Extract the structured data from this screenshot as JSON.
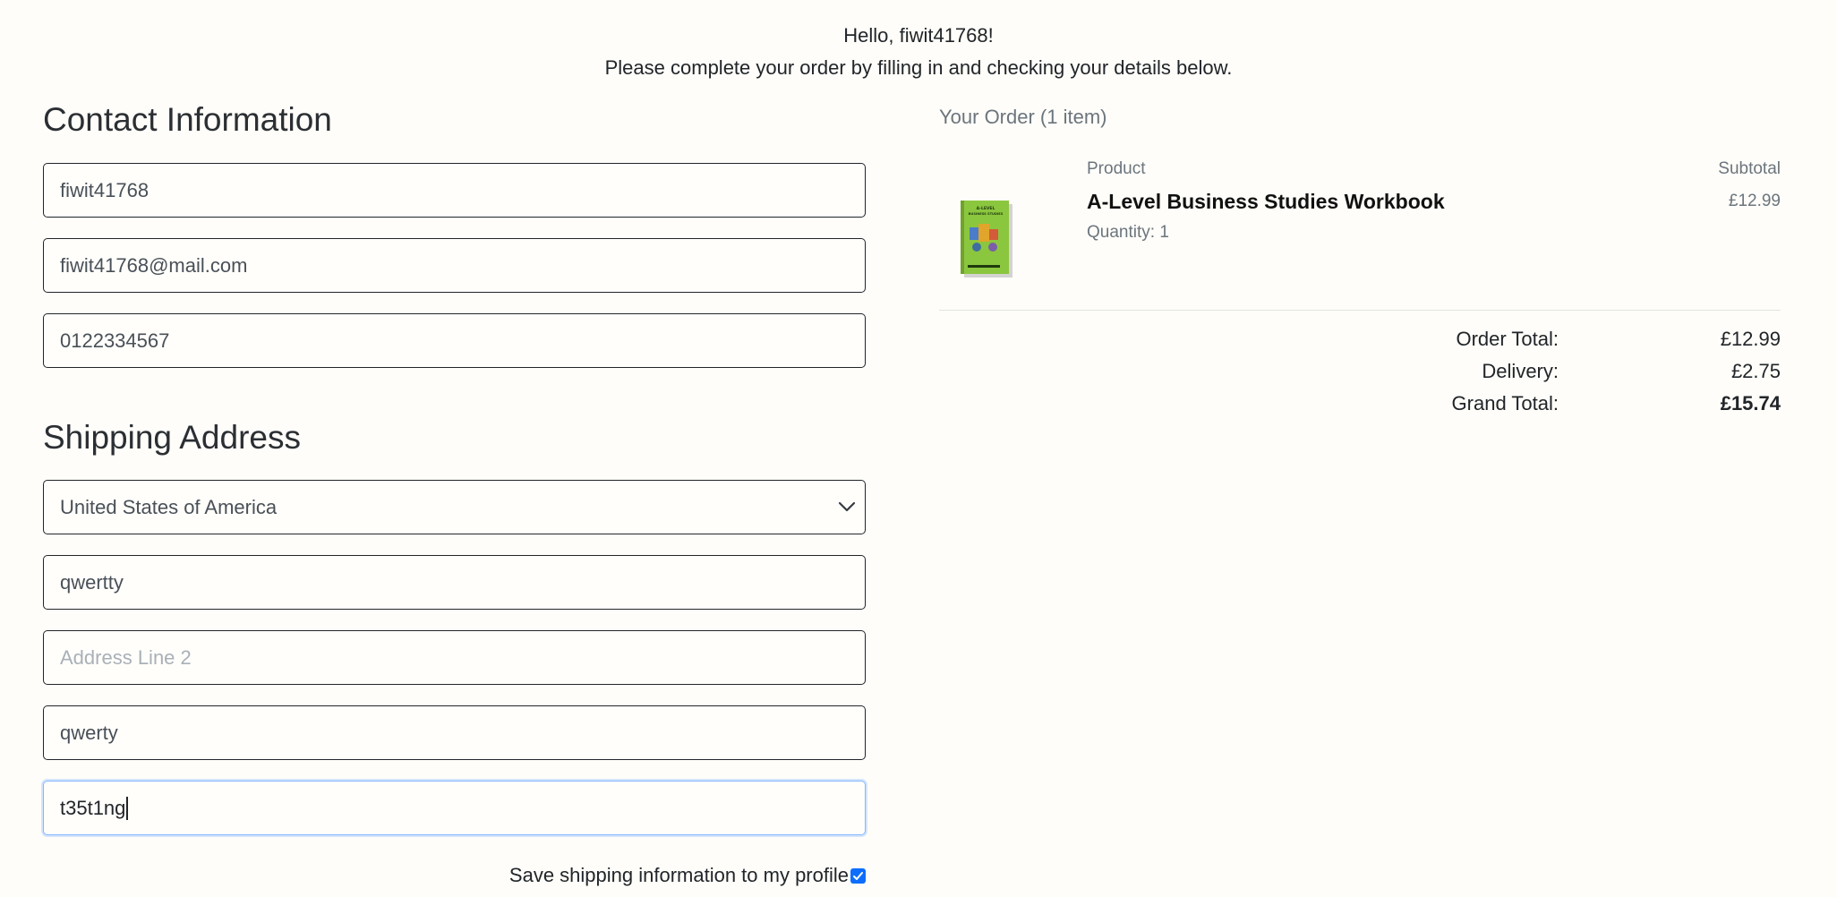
{
  "header": {
    "greeting": "Hello, fiwit41768!",
    "instructions": "Please complete your order by filling in and checking your details below."
  },
  "contact": {
    "title": "Contact Information",
    "name_value": "fiwit41768",
    "email_value": "fiwit41768@mail.com",
    "phone_value": "0122334567"
  },
  "shipping": {
    "title": "Shipping Address",
    "country_selected": "United States of America",
    "address_line1_value": "qwertty",
    "address_line2_placeholder": "Address Line 2",
    "city_value": "qwerty",
    "postcode_value": "t35t1ng",
    "save_label": "Save shipping information to my profile",
    "save_checked": true
  },
  "order": {
    "header": "Your Order (1 item)",
    "product_col": "Product",
    "subtotal_col": "Subtotal",
    "items": [
      {
        "name": "A-Level Business Studies Workbook",
        "quantity": "Quantity: 1",
        "price": "£12.99",
        "cover_title": "A-LEVEL BUSINESS STUDIES",
        "cover_color": "#8bc63f"
      }
    ],
    "totals": {
      "order_total_label": "Order Total:",
      "order_total_value": "£12.99",
      "delivery_label": "Delivery:",
      "delivery_value": "£2.75",
      "grand_total_label": "Grand Total:",
      "grand_total_value": "£15.74"
    }
  },
  "colors": {
    "background": "#fefdf9",
    "focus_ring": "#86b7fe",
    "checkbox": "#0d6efd"
  }
}
